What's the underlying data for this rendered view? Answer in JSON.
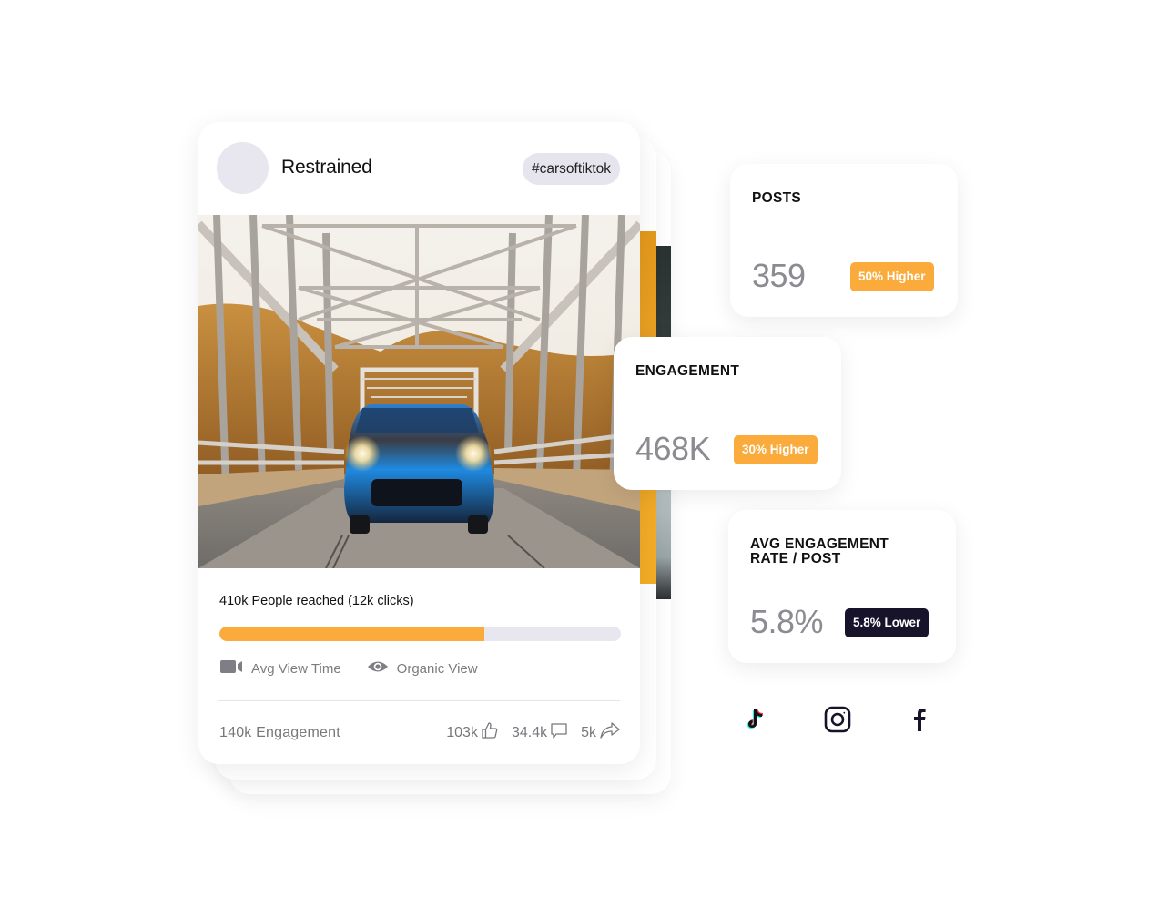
{
  "post": {
    "username": "Restrained",
    "hashtag": "#carsoftiktok",
    "image_alt": "Blue car on a steel truss bridge",
    "reach_text": "410k People reached (12k clicks)",
    "reach_progress_percent": 66,
    "meta": [
      {
        "icon": "video-camera-icon",
        "label": "Avg View Time"
      },
      {
        "icon": "eye-icon",
        "label": "Organic View"
      }
    ],
    "engagement_text": "140k Engagement",
    "stats": [
      {
        "icon": "thumbs-up-icon",
        "value": "103k"
      },
      {
        "icon": "comment-icon",
        "value": "34.4k"
      },
      {
        "icon": "share-icon",
        "value": "5k"
      }
    ]
  },
  "metrics": [
    {
      "label": "POSTS",
      "value": "359",
      "badge": "50% Higher",
      "badge_type": "higher"
    },
    {
      "label": "ENGAGEMENT",
      "value": "468K",
      "badge": "30% Higher",
      "badge_type": "higher"
    },
    {
      "label": "AVG ENGAGEMENT RATE / POST",
      "value": "5.8%",
      "badge": "5.8% Lower",
      "badge_type": "lower"
    }
  ],
  "social": [
    {
      "name": "TikTok",
      "icon": "tiktok-icon"
    },
    {
      "name": "Instagram",
      "icon": "instagram-icon"
    },
    {
      "name": "Facebook",
      "icon": "facebook-icon"
    }
  ],
  "colors": {
    "accent_orange": "#fbab3b",
    "badge_dark": "#17132b",
    "progress_track": "#e8e7f0",
    "muted_text": "#7c7b80"
  }
}
